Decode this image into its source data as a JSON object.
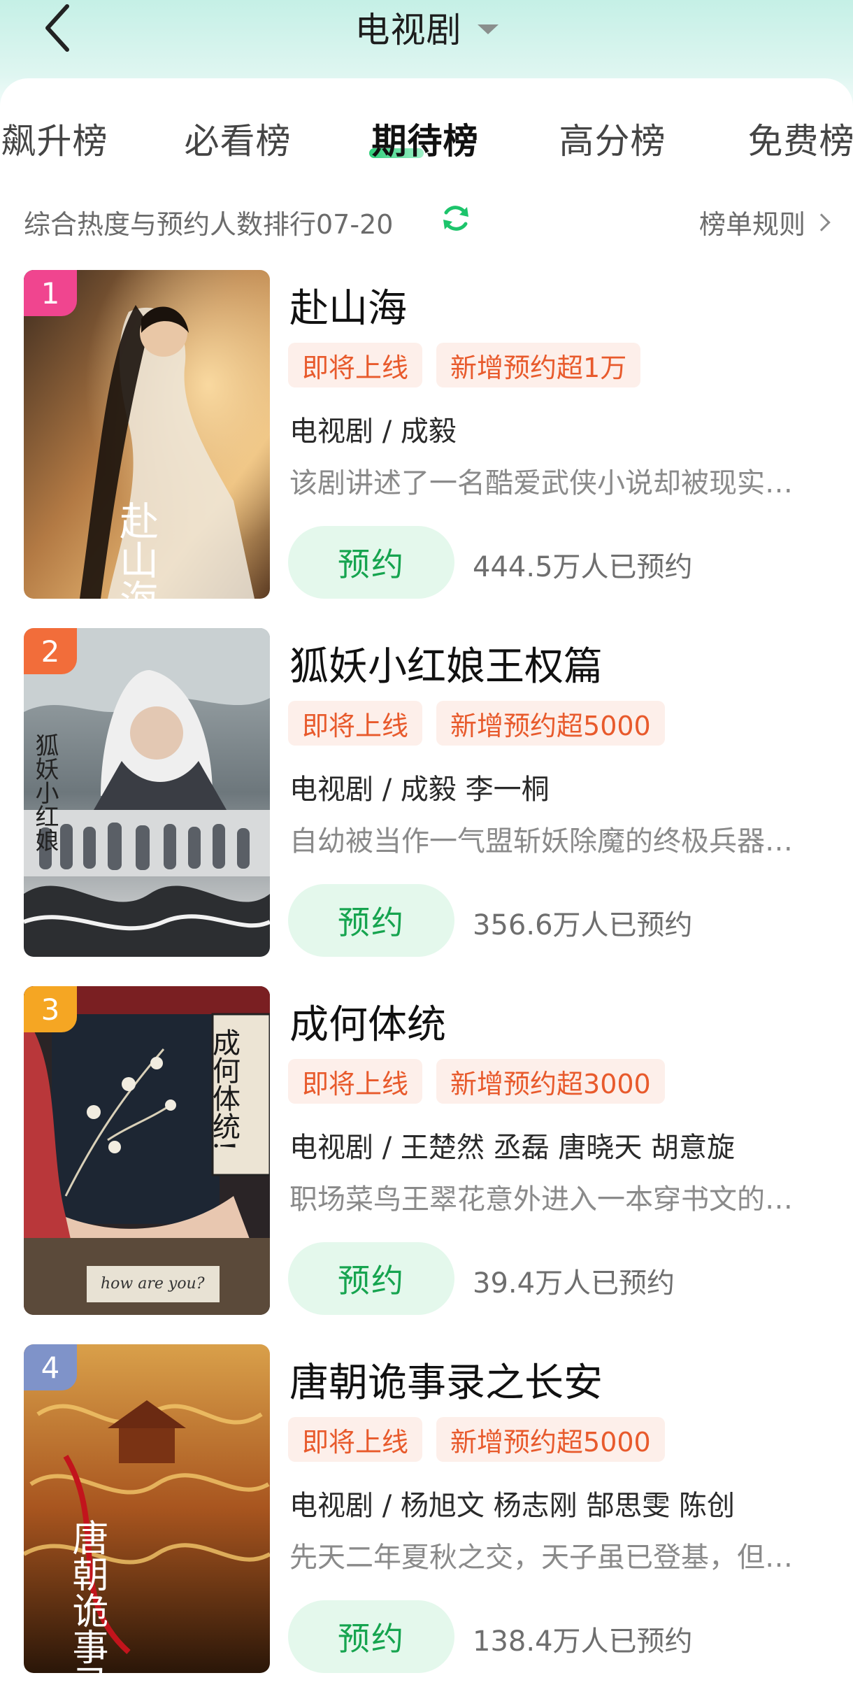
{
  "header": {
    "title": "电视剧"
  },
  "tabs": [
    {
      "label": "飙升榜"
    },
    {
      "label": "必看榜"
    },
    {
      "label": "期待榜",
      "active": true
    },
    {
      "label": "高分榜"
    },
    {
      "label": "免费榜"
    }
  ],
  "subbar": {
    "description": "综合热度与预约人数排行07-20",
    "rules_label": "榜单规则"
  },
  "reserve_label": "预约",
  "items": [
    {
      "rank": "1",
      "rank_color": "#f0458f",
      "title": "赴山海",
      "tags": [
        "即将上线",
        "新增预约超1万"
      ],
      "meta": "电视剧 / 成毅",
      "synopsis": "该剧讲述了一名酷爱武侠小说却被现实…",
      "count": "444.5万人已预约",
      "poster_title": "赴山海"
    },
    {
      "rank": "2",
      "rank_color": "#f26d3a",
      "title": "狐妖小红娘王权篇",
      "tags": [
        "即将上线",
        "新增预约超5000"
      ],
      "meta": "电视剧 / 成毅 李一桐",
      "synopsis": "自幼被当作一气盟斩妖除魔的终极兵器…",
      "count": "356.6万人已预约",
      "poster_title": "狐妖小红娘"
    },
    {
      "rank": "3",
      "rank_color": "#f5a623",
      "title": "成何体统",
      "tags": [
        "即将上线",
        "新增预约超3000"
      ],
      "meta": "电视剧 / 王楚然 丞磊 唐晓天 胡意旋",
      "synopsis": "职场菜鸟王翠花意外进入一本穿书文的…",
      "count": "39.4万人已预约",
      "poster_title": "成何体统!",
      "poster_subtext": "how are you?"
    },
    {
      "rank": "4",
      "rank_color": "#7f93c9",
      "title": "唐朝诡事录之长安",
      "tags": [
        "即将上线",
        "新增预约超5000"
      ],
      "meta": "电视剧 / 杨旭文 杨志刚 郜思雯 陈创",
      "synopsis": "先天二年夏秋之交，天子虽已登基，但…",
      "count": "138.4万人已预约",
      "poster_title": "唐朝诡事录"
    }
  ]
}
